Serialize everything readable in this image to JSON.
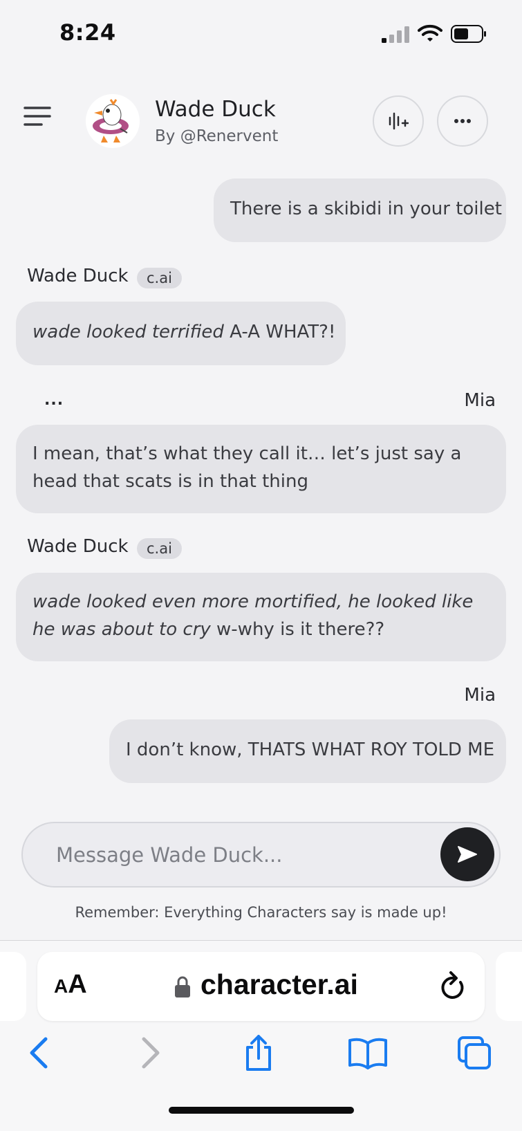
{
  "status_bar": {
    "time": "8:24"
  },
  "header": {
    "character_name": "Wade Duck",
    "creator": "By @Renervent"
  },
  "messages": [
    {
      "sender": "user",
      "text": "There is a skibidi in your toilet"
    },
    {
      "sender": "Wade Duck",
      "badge": "c.ai",
      "italic": "wade looked terrified",
      "text": " A-A WHAT?!"
    },
    {
      "sender": "Mia",
      "options_label": "...",
      "text": "I mean, that’s what they call it… let’s just say a head that scats is in that thing"
    },
    {
      "sender": "Wade Duck",
      "badge": "c.ai",
      "italic": "wade looked even more mortified, he looked like he was about to cry",
      "text": " w-why is it there??"
    },
    {
      "sender": "Mia",
      "text": "I don’t know, THATS WHAT ROY TOLD ME"
    }
  ],
  "composer": {
    "placeholder": "Message Wade Duck..."
  },
  "disclaimer": "Remember: Everything Characters say is made up!",
  "browser": {
    "text_size_small": "A",
    "text_size_large": "A",
    "url": "character.ai"
  },
  "colors": {
    "accent_blue": "#1a7cf0",
    "bubble": "#e4e4e8",
    "background": "#f4f4f6",
    "send_button": "#1f2023"
  }
}
